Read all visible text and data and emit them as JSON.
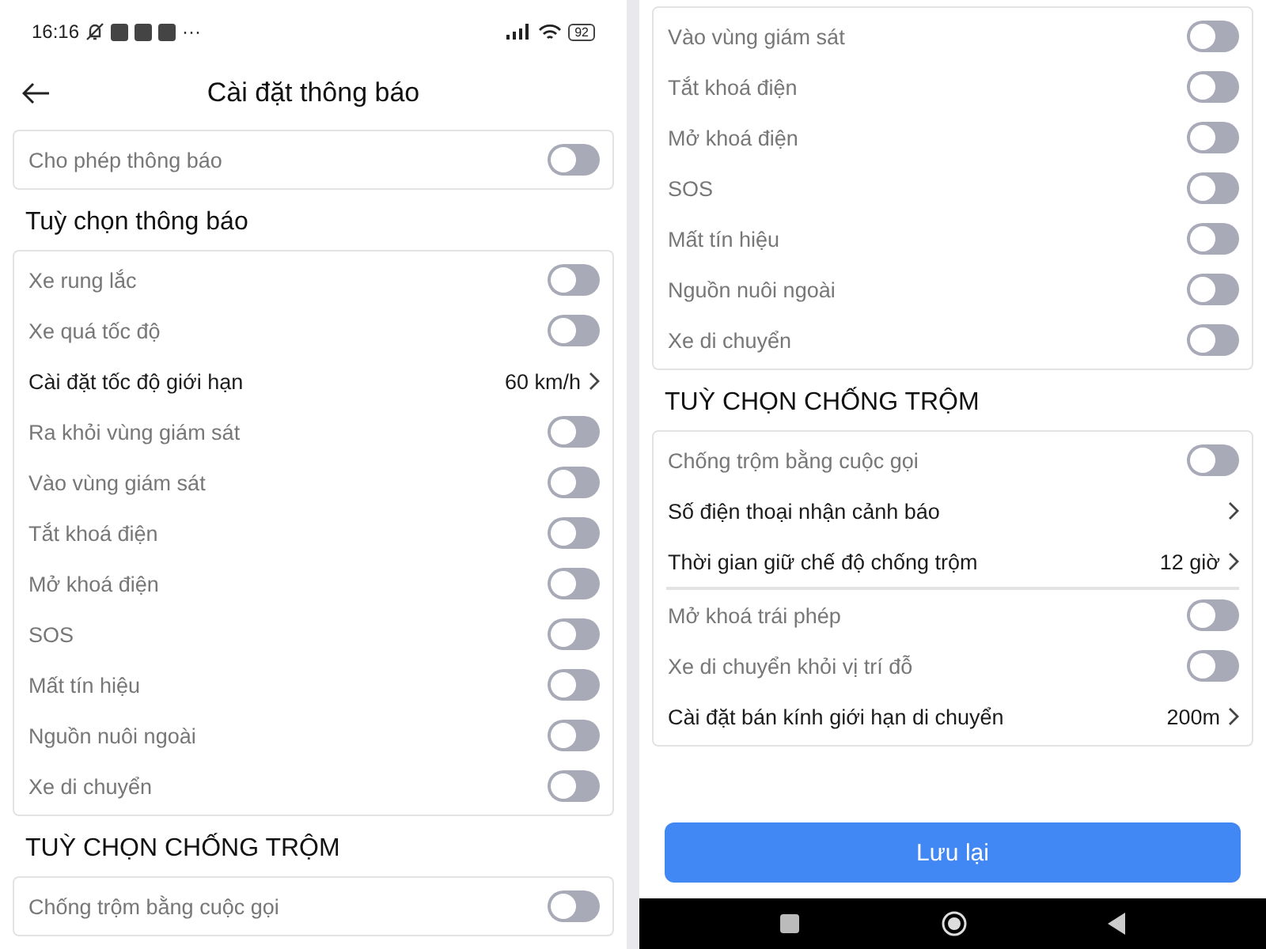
{
  "screens": [
    {
      "status_bar": {
        "time": "16:16",
        "more": "···",
        "battery": "92"
      },
      "header": {
        "title": "Cài đặt thông báo"
      },
      "allow": {
        "label": "Cho phép thông báo",
        "on": false
      },
      "sections": [
        {
          "title": "Tuỳ chọn thông báo",
          "groups": [
            [
              {
                "kind": "toggle",
                "label": "Xe rung lắc",
                "on": false
              },
              {
                "kind": "toggle",
                "label": "Xe quá tốc độ",
                "on": false
              },
              {
                "kind": "link",
                "label": "Cài đặt tốc độ giới hạn",
                "value": "60 km/h"
              },
              {
                "kind": "toggle",
                "label": "Ra khỏi vùng giám sát",
                "on": false
              },
              {
                "kind": "toggle",
                "label": "Vào vùng giám sát",
                "on": false
              },
              {
                "kind": "toggle",
                "label": "Tắt khoá điện",
                "on": false
              },
              {
                "kind": "toggle",
                "label": "Mở khoá điện",
                "on": false
              },
              {
                "kind": "toggle",
                "label": "SOS",
                "on": false
              },
              {
                "kind": "toggle",
                "label": "Mất tín hiệu",
                "on": false
              },
              {
                "kind": "toggle",
                "label": "Nguồn nuôi ngoài",
                "on": false
              },
              {
                "kind": "toggle",
                "label": "Xe di chuyển",
                "on": false
              }
            ]
          ]
        },
        {
          "title": "TUỲ CHỌN CHỐNG TRỘM",
          "groups": [
            [
              {
                "kind": "toggle",
                "label": "Chống trộm bằng cuộc gọi",
                "on": false
              }
            ]
          ]
        }
      ]
    },
    {
      "sections": [
        {
          "groups": [
            [
              {
                "kind": "toggle",
                "label": "Vào vùng giám sát",
                "on": false
              },
              {
                "kind": "toggle",
                "label": "Tắt khoá điện",
                "on": false
              },
              {
                "kind": "toggle",
                "label": "Mở khoá điện",
                "on": false
              },
              {
                "kind": "toggle",
                "label": "SOS",
                "on": false
              },
              {
                "kind": "toggle",
                "label": "Mất tín hiệu",
                "on": false
              },
              {
                "kind": "toggle",
                "label": "Nguồn nuôi ngoài",
                "on": false
              },
              {
                "kind": "toggle",
                "label": "Xe di chuyển",
                "on": false
              }
            ]
          ]
        },
        {
          "title": "TUỲ CHỌN CHỐNG TRỘM",
          "groups": [
            [
              {
                "kind": "toggle",
                "label": "Chống trộm bằng cuộc gọi",
                "on": false
              },
              {
                "kind": "link",
                "label": "Số điện thoại nhận cảnh báo"
              },
              {
                "kind": "link",
                "label": "Thời gian giữ chế độ chống trộm",
                "value": "12 giờ"
              }
            ],
            [
              {
                "kind": "toggle",
                "label": "Mở khoá trái phép",
                "on": false
              },
              {
                "kind": "toggle",
                "label": "Xe di chuyển khỏi vị trí đỗ",
                "on": false
              },
              {
                "kind": "link",
                "label": "Cài đặt bán kính giới hạn di chuyển",
                "value": "200m"
              }
            ]
          ]
        }
      ],
      "footer": {
        "button": "Lưu lại"
      }
    }
  ]
}
